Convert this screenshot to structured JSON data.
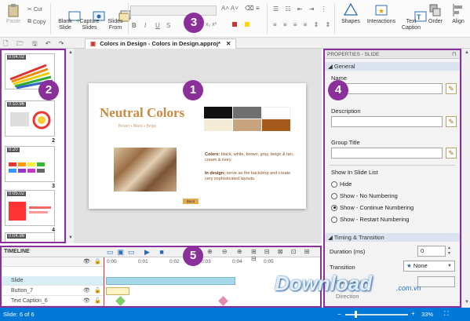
{
  "ribbon": {
    "paste": "Paste",
    "cut": "Cut",
    "copy": "Copy",
    "blank_slide": "Blank\nSlide",
    "capture_slides": "Capture\nSlides",
    "slides_from": "Slides\nFrom",
    "shapes": "Shapes",
    "interactions": "Interactions",
    "text_caption": "Text\nCaption",
    "order": "Order",
    "align": "Align"
  },
  "document": {
    "tab_title": "Colors in Design - Colors in Design.approj*"
  },
  "filmstrip": {
    "thumbs": [
      {
        "time": "0:04.02",
        "num": ""
      },
      {
        "time": "0:10.96",
        "num": "2"
      },
      {
        "time": "0:20",
        "num": "3"
      },
      {
        "time": "0:05.02",
        "num": "4"
      },
      {
        "time": "0:04.98",
        "num": ""
      }
    ]
  },
  "slide": {
    "title": "Neutral Colors",
    "subtitle": "Brown • Black • Beige",
    "colors_label": "Colors:",
    "colors_text": "black, white, brown, gray, beige & tan, cream & ivory",
    "design_label": "In design:",
    "design_text": "serve as the backdrop and create very sophisticated layouts.",
    "button_text": "Back",
    "swatches": [
      "#111111",
      "#6f6f6f",
      "#ffffff",
      "#f3ebd6",
      "#c8a47e",
      "#a65a1b"
    ]
  },
  "properties": {
    "header": "PROPERTIES - SLIDE",
    "general": "General",
    "name_label": "Name",
    "description_label": "Description",
    "group_title_label": "Group Title",
    "show_in_list_label": "Show In Slide List",
    "radio_options": [
      "Hide",
      "Show - No Numbering",
      "Show - Continue Numbering",
      "Show - Restart Numbering"
    ],
    "selected_radio": 2,
    "timing_section": "Timing & Transition",
    "duration_label": "Duration (ms)",
    "duration_value": "0",
    "transition_label": "Transition",
    "transition_value": "None",
    "duration2_label": "Duration (ms)",
    "direction_label": "Direction"
  },
  "timeline": {
    "title": "TIMELINE",
    "ticks": [
      "0:00",
      "0:01",
      "0:02",
      "0:03",
      "0:04",
      "0:05"
    ],
    "rows": [
      "Slide",
      "Button_7",
      "Text Caption_6"
    ]
  },
  "status": {
    "slide_info": "Slide: 6 of 6",
    "zoom": "33%"
  },
  "watermark": {
    "text": "Download",
    "domain": ".com.vn"
  },
  "callouts": [
    "1",
    "2",
    "3",
    "4",
    "5"
  ]
}
